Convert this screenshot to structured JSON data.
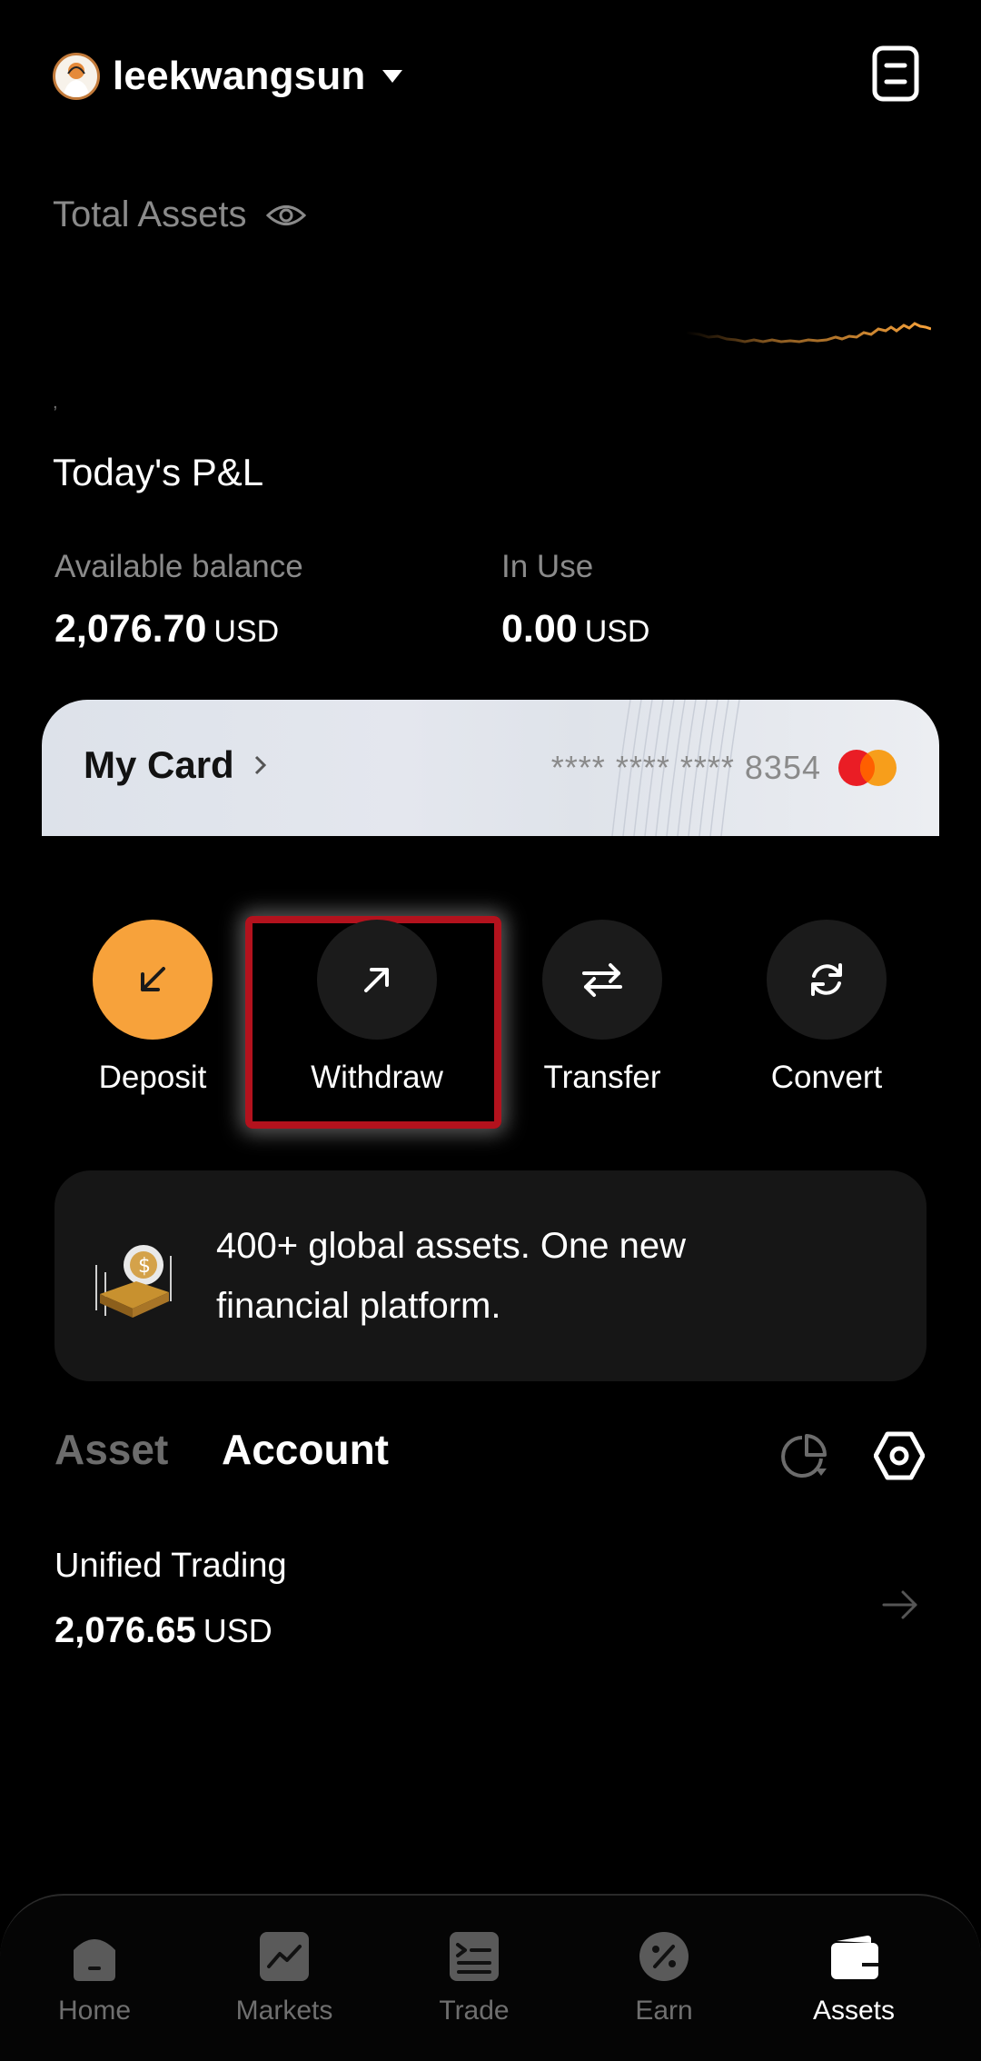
{
  "header": {
    "username": "leekwangsun"
  },
  "summary": {
    "total_assets_label": "Total Assets",
    "small_mark": ",",
    "pnl_label": "Today's P&L"
  },
  "balances": {
    "available": {
      "label": "Available balance",
      "value": "2,076.70",
      "unit": "USD"
    },
    "in_use": {
      "label": "In Use",
      "value": "0.00",
      "unit": "USD"
    }
  },
  "card": {
    "title": "My Card",
    "number": "**** **** **** 8354"
  },
  "actions": [
    {
      "label": "Deposit",
      "icon": "arrow-down-left-icon"
    },
    {
      "label": "Withdraw",
      "icon": "arrow-up-right-icon"
    },
    {
      "label": "Transfer",
      "icon": "transfer-arrows-icon"
    },
    {
      "label": "Convert",
      "icon": "refresh-icon"
    }
  ],
  "promo": {
    "text": "400+ global assets. One new financial platform."
  },
  "tabs": {
    "asset": "Asset",
    "account": "Account",
    "active": "Account"
  },
  "accounts": [
    {
      "name": "Unified Trading",
      "value": "2,076.65",
      "unit": "USD"
    }
  ],
  "bottom_nav": [
    {
      "label": "Home",
      "icon": "home-icon"
    },
    {
      "label": "Markets",
      "icon": "chart-icon"
    },
    {
      "label": "Trade",
      "icon": "trade-icon"
    },
    {
      "label": "Earn",
      "icon": "percent-icon"
    },
    {
      "label": "Assets",
      "icon": "wallet-icon",
      "active": true
    }
  ],
  "colors": {
    "accent": "#f7a23b",
    "highlight": "#b3121d",
    "background": "#000000",
    "muted": "#8a8a8a"
  }
}
